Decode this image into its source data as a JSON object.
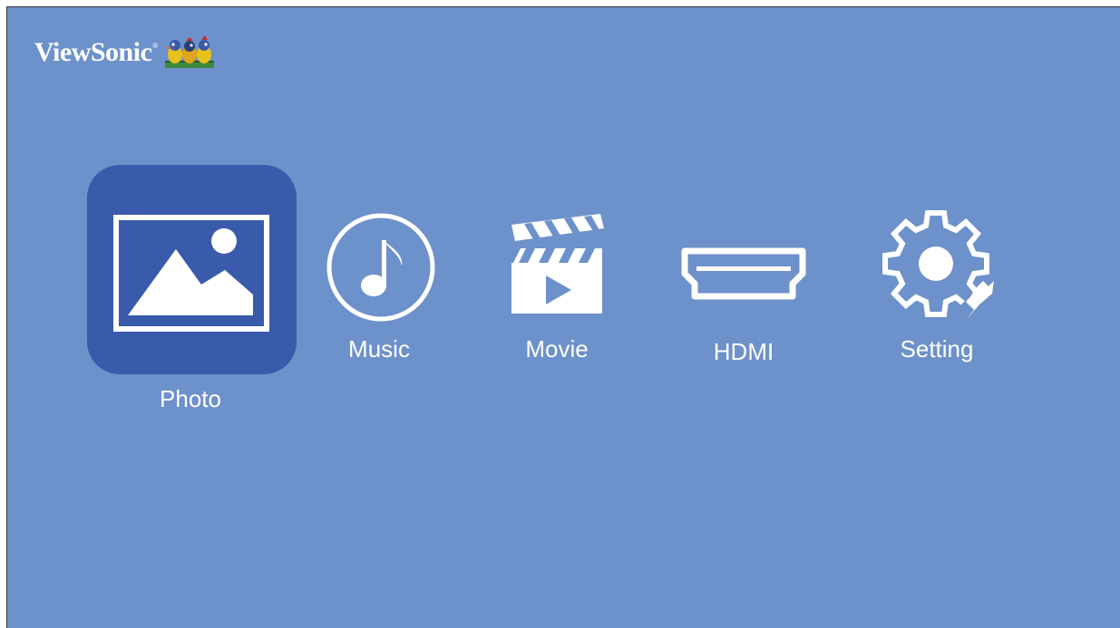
{
  "brand": {
    "name": "ViewSonic",
    "registered_mark": "®"
  },
  "colors": {
    "background": "#6d91ca",
    "selected_tile": "#3a5bab",
    "icon": "#ffffff"
  },
  "menu": {
    "selected_index": 0,
    "items": [
      {
        "label": "Photo",
        "icon": "photo-icon"
      },
      {
        "label": "Music",
        "icon": "music-note-icon"
      },
      {
        "label": "Movie",
        "icon": "clapperboard-icon"
      },
      {
        "label": "HDMI",
        "icon": "hdmi-port-icon"
      },
      {
        "label": "Setting",
        "icon": "gear-wrench-icon"
      }
    ]
  }
}
